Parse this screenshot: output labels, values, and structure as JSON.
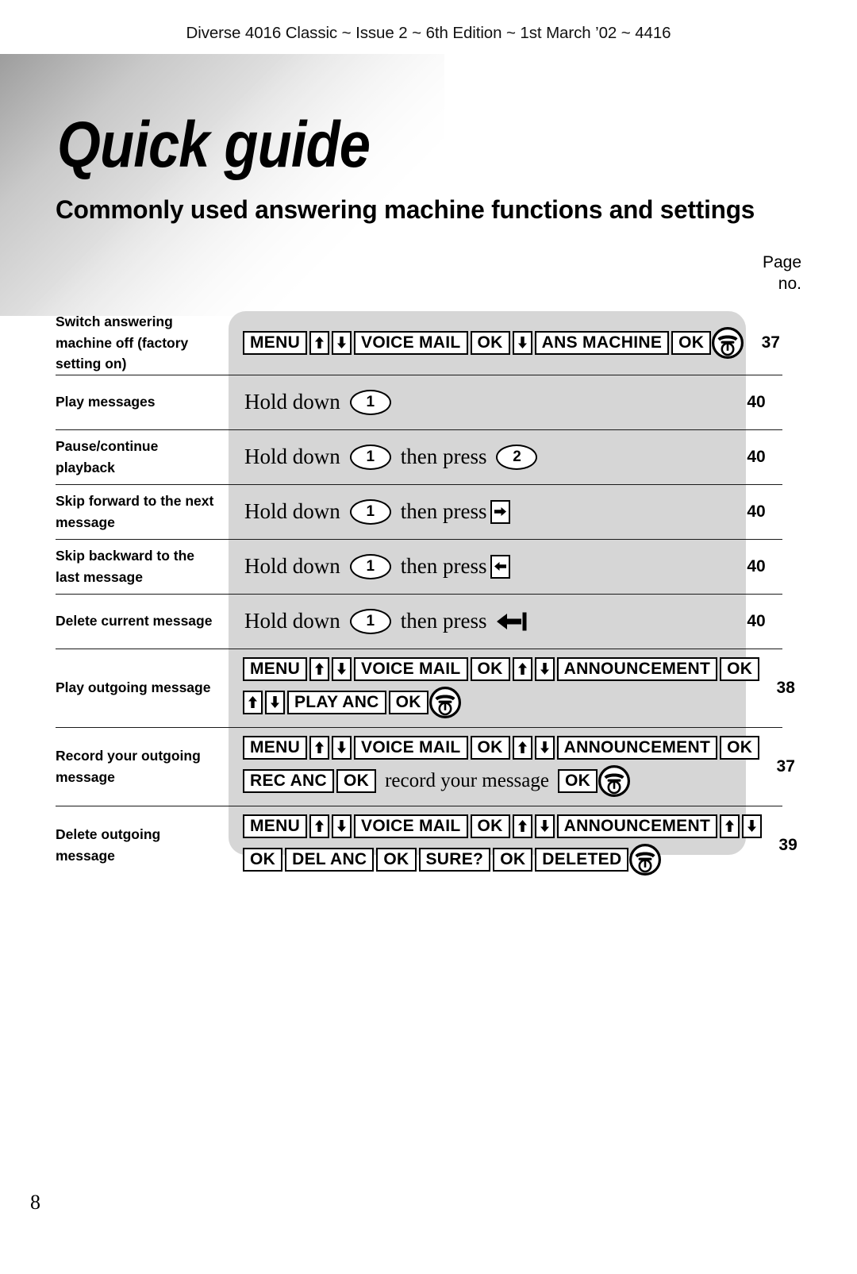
{
  "running_head": "Diverse 4016 Classic ~ Issue 2 ~ 6th Edition ~ 1st March ’02 ~ 4416",
  "title": "Quick guide",
  "subtitle": "Commonly used answering machine functions and settings",
  "page_column_header": {
    "line1": "Page",
    "line2": "no."
  },
  "folio": "8",
  "colors": {
    "panel": "#d6d6d6",
    "rule": "#1a1a1a",
    "key_fill": "#ffffff",
    "ink": "#000000"
  },
  "icons": {
    "up_arrow": "arrow-up-icon",
    "down_arrow": "arrow-down-icon",
    "right_arrow": "arrow-right-icon",
    "left_arrow": "arrow-left-icon",
    "delete_arrow": "delete-arrow-icon",
    "phone": "phone-hangup-icon"
  },
  "rows": [
    {
      "label": "Switch answering machine off (factory setting on)",
      "page": "37",
      "lines": [
        [
          {
            "type": "key",
            "text": "MENU"
          },
          {
            "type": "arrow",
            "dir": "up"
          },
          {
            "type": "arrow",
            "dir": "down"
          },
          {
            "type": "key",
            "text": "VOICE MAIL"
          },
          {
            "type": "key",
            "text": "OK"
          },
          {
            "type": "arrow",
            "dir": "down"
          },
          {
            "type": "key",
            "text": "ANS MACHINE"
          },
          {
            "type": "key",
            "text": "OK"
          },
          {
            "type": "phone"
          }
        ]
      ]
    },
    {
      "label": "Play messages",
      "page": "40",
      "lines": [
        [
          {
            "type": "prose",
            "text": "Hold down"
          },
          {
            "type": "oval",
            "text": "1"
          }
        ]
      ]
    },
    {
      "label": "Pause/continue playback",
      "page": "40",
      "lines": [
        [
          {
            "type": "prose",
            "text": "Hold down"
          },
          {
            "type": "oval",
            "text": "1"
          },
          {
            "type": "prose",
            "text": "then press"
          },
          {
            "type": "oval",
            "text": "2"
          }
        ]
      ]
    },
    {
      "label": "Skip forward to the next message",
      "page": "40",
      "lines": [
        [
          {
            "type": "prose",
            "text": "Hold down"
          },
          {
            "type": "oval",
            "text": "1"
          },
          {
            "type": "prose",
            "text": "then press"
          },
          {
            "type": "arrow",
            "dir": "right"
          }
        ]
      ]
    },
    {
      "label": "Skip backward to the last message",
      "page": "40",
      "lines": [
        [
          {
            "type": "prose",
            "text": "Hold down"
          },
          {
            "type": "oval",
            "text": "1"
          },
          {
            "type": "prose",
            "text": "then press"
          },
          {
            "type": "arrow",
            "dir": "left"
          }
        ]
      ]
    },
    {
      "label": "Delete current message",
      "page": "40",
      "lines": [
        [
          {
            "type": "prose",
            "text": "Hold down"
          },
          {
            "type": "oval",
            "text": "1"
          },
          {
            "type": "prose",
            "text": "then press"
          },
          {
            "type": "delete"
          }
        ]
      ]
    },
    {
      "label": "Play outgoing message",
      "page": "38",
      "lines": [
        [
          {
            "type": "key",
            "text": "MENU"
          },
          {
            "type": "arrow",
            "dir": "up"
          },
          {
            "type": "arrow",
            "dir": "down"
          },
          {
            "type": "key",
            "text": "VOICE MAIL"
          },
          {
            "type": "key",
            "text": "OK"
          },
          {
            "type": "arrow",
            "dir": "up"
          },
          {
            "type": "arrow",
            "dir": "down"
          },
          {
            "type": "key",
            "text": "ANNOUNCEMENT"
          },
          {
            "type": "key",
            "text": "OK"
          }
        ],
        [
          {
            "type": "arrow",
            "dir": "up"
          },
          {
            "type": "arrow",
            "dir": "down"
          },
          {
            "type": "key",
            "text": "PLAY ANC"
          },
          {
            "type": "key",
            "text": "OK"
          },
          {
            "type": "phone"
          }
        ]
      ]
    },
    {
      "label": "Record your outgoing message",
      "page": "37",
      "lines": [
        [
          {
            "type": "key",
            "text": "MENU"
          },
          {
            "type": "arrow",
            "dir": "up"
          },
          {
            "type": "arrow",
            "dir": "down"
          },
          {
            "type": "key",
            "text": "VOICE MAIL"
          },
          {
            "type": "key",
            "text": "OK"
          },
          {
            "type": "arrow",
            "dir": "up"
          },
          {
            "type": "arrow",
            "dir": "down"
          },
          {
            "type": "key",
            "text": "ANNOUNCEMENT"
          },
          {
            "type": "key",
            "text": "OK"
          }
        ],
        [
          {
            "type": "key",
            "text": "REC ANC"
          },
          {
            "type": "key",
            "text": "OK"
          },
          {
            "type": "prose-small",
            "text": "record your message"
          },
          {
            "type": "key",
            "text": "OK"
          },
          {
            "type": "phone"
          }
        ]
      ]
    },
    {
      "label": "Delete outgoing message",
      "page": "39",
      "lines": [
        [
          {
            "type": "key",
            "text": "MENU"
          },
          {
            "type": "arrow",
            "dir": "up"
          },
          {
            "type": "arrow",
            "dir": "down"
          },
          {
            "type": "key",
            "text": "VOICE MAIL"
          },
          {
            "type": "key",
            "text": "OK"
          },
          {
            "type": "arrow",
            "dir": "up"
          },
          {
            "type": "arrow",
            "dir": "down"
          },
          {
            "type": "key",
            "text": "ANNOUNCEMENT"
          },
          {
            "type": "arrow",
            "dir": "up"
          },
          {
            "type": "arrow",
            "dir": "down"
          }
        ],
        [
          {
            "type": "key",
            "text": "OK"
          },
          {
            "type": "key",
            "text": "DEL ANC"
          },
          {
            "type": "key",
            "text": "OK"
          },
          {
            "type": "key",
            "text": "SURE?"
          },
          {
            "type": "key",
            "text": "OK"
          },
          {
            "type": "key",
            "text": "DELETED"
          },
          {
            "type": "phone"
          }
        ]
      ]
    }
  ]
}
